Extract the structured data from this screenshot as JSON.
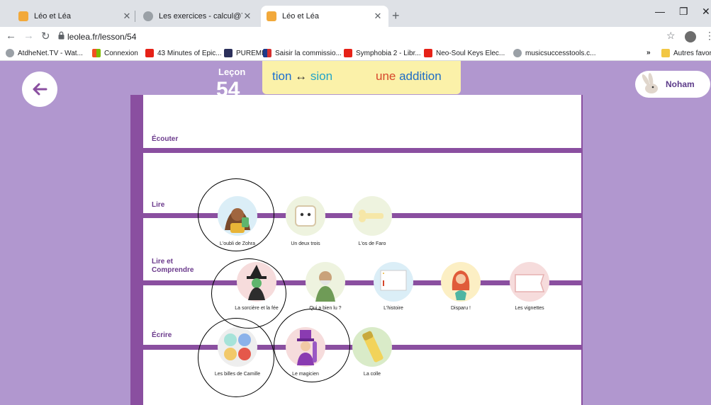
{
  "browser": {
    "tabs": [
      {
        "title": "Léo et Léa",
        "active": false
      },
      {
        "title": "Les exercices - calcul@TICE",
        "active": false
      },
      {
        "title": "Léo et Léa",
        "active": true
      }
    ],
    "url": "leolea.fr/lesson/54",
    "bookmarks": [
      "AtdheNet.TV - Wat...",
      "Connexion",
      "43 Minutes of Epic...",
      "PUREMIX",
      "Saisir la commissio...",
      "Symphobia 2 - Libr...",
      "Neo-Soul Keys Elec...",
      "musicsuccesstools.c..."
    ],
    "other_bookmarks": "Autres favoris",
    "overflow": "»"
  },
  "lesson": {
    "label": "Leçon",
    "number": "54",
    "banner_left": [
      "tion",
      " ↔ ",
      "sion"
    ],
    "banner_right": [
      "une",
      " addition"
    ]
  },
  "profile": {
    "name": "Noham"
  },
  "sections": {
    "ecouter": "Écouter",
    "lire": "Lire",
    "comprendre_1": "Lire et",
    "comprendre_2": "Comprendre",
    "ecrire": "Écrire"
  },
  "activities": {
    "lire": [
      "L'oubli de Zohra",
      "Un deux trois",
      "L'os de Faro"
    ],
    "comprendre": [
      "La sorcière et la fée",
      "Qui a bien lu ?",
      "L'histoire",
      "Disparu !",
      "Les vignettes"
    ],
    "ecrire": [
      "Les billes de Camille",
      "Le magicien",
      "La colle"
    ]
  },
  "colors": {
    "page_bg": "#b197cf",
    "panel": "#8a4fa0",
    "banner": "#fbf1a9",
    "sound_tion": "#1a6ed1",
    "sound_sion": "#22a4c8",
    "word_une": "#d6472b",
    "word_addition": "#1d6cc6"
  }
}
